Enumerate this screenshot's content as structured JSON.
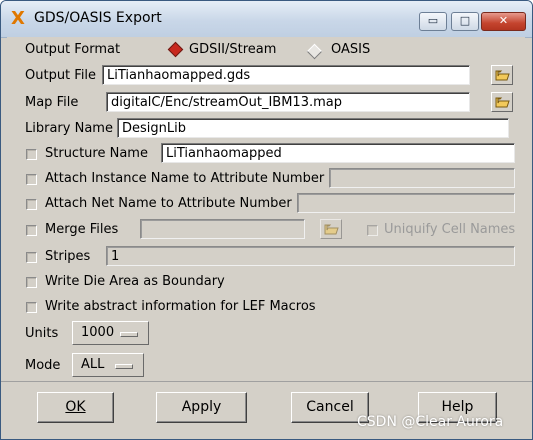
{
  "window": {
    "title": "GDS/OASIS Export",
    "controls": {
      "minimize": "▭",
      "maximize": "□",
      "close": "✕"
    }
  },
  "output_format": {
    "label": "Output Format",
    "options": [
      "GDSII/Stream",
      "OASIS"
    ],
    "selected": "GDSII/Stream"
  },
  "output_file": {
    "label": "Output File",
    "value": "LiTianhaomapped.gds"
  },
  "map_file": {
    "label": "Map File",
    "value": "digitalC/Enc/streamOut_IBM13.map"
  },
  "library_name": {
    "label": "Library Name",
    "value": "DesignLib"
  },
  "structure_name": {
    "label": "Structure Name",
    "value": "LiTianhaomapped",
    "checked": false
  },
  "attach_instance": {
    "label": "Attach Instance Name to Attribute Number",
    "value": "",
    "checked": false
  },
  "attach_net": {
    "label": "Attach Net Name to Attribute Number",
    "value": "",
    "checked": false
  },
  "merge_files": {
    "label": "Merge Files",
    "value": "",
    "checked": false,
    "uniquify_label": "Uniquify Cell Names",
    "uniquify_checked": false
  },
  "stripes": {
    "label": "Stripes",
    "value": "1",
    "checked": false
  },
  "write_die_area": {
    "label": "Write Die Area as Boundary",
    "checked": false
  },
  "write_abstract": {
    "label": "Write abstract information for LEF Macros",
    "checked": false
  },
  "units": {
    "label": "Units",
    "value": "1000"
  },
  "mode": {
    "label": "Mode",
    "value": "ALL"
  },
  "buttons": {
    "ok": "OK",
    "apply": "Apply",
    "cancel": "Cancel",
    "help": "Help"
  },
  "watermark": "CSDN @Clear Aurora",
  "colors": {
    "accent": "#c8281e",
    "dialog_bg": "#d4d0c8",
    "titlebar": "#c9d7e8",
    "close": "#c4442e"
  }
}
